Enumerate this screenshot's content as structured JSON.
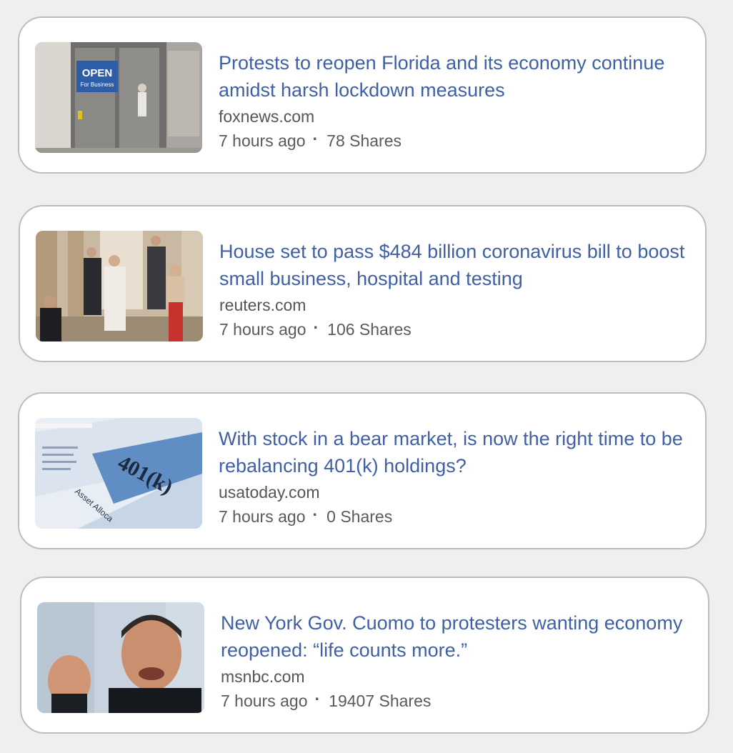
{
  "articles": [
    {
      "title": "Protests to reopen Florida and its economy continue amidst harsh lockdown measures",
      "source": "foxnews.com",
      "time": "7 hours ago",
      "separator": "·",
      "shares": "78 Shares",
      "image_sign": {
        "big": "OPEN",
        "small": "For Business"
      }
    },
    {
      "title": "House set to pass $484 billion coronavirus bill to boost small business, hospital and testing",
      "source": "reuters.com",
      "time": "7 hours ago",
      "separator": "·",
      "shares": "106 Shares"
    },
    {
      "title": "With stock in a bear market, is now the right time to be rebalancing 401(k) holdings?",
      "source": "usatoday.com",
      "time": "7 hours ago",
      "separator": "·",
      "shares": "0 Shares",
      "image_text": {
        "main": "401(k)",
        "sub": "Asset Alloca"
      }
    },
    {
      "title": "New York Gov. Cuomo to protesters wanting economy reopened: “life counts more.”",
      "source": "msnbc.com",
      "time": "7 hours ago",
      "separator": "·",
      "shares": "19407 Shares"
    }
  ],
  "colors": {
    "title": "#3f5fa6",
    "meta": "#5a5a5a",
    "card_border": "#bdbdbd",
    "background": "#efefef"
  }
}
